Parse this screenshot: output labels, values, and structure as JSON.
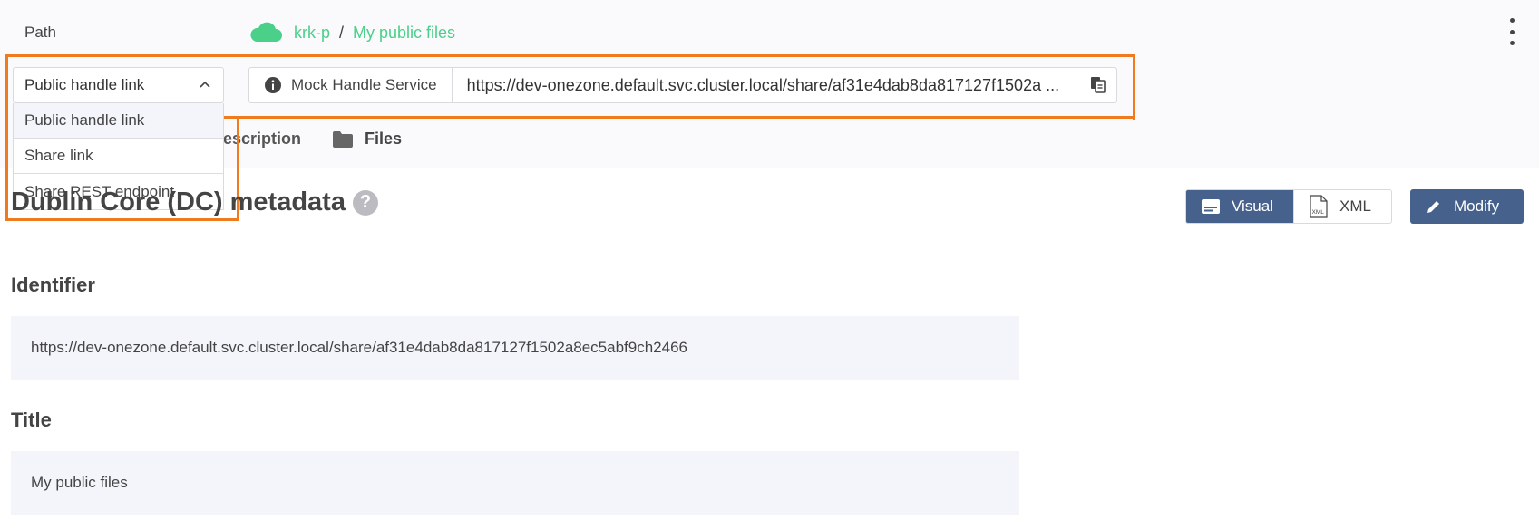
{
  "path": {
    "label": "Path",
    "crumbs": [
      "krk-p",
      "My public files"
    ],
    "separator": "/"
  },
  "link_selector": {
    "selected": "Public handle link",
    "options": [
      "Public handle link",
      "Share link",
      "Share REST endpoint"
    ]
  },
  "handle": {
    "service_name": "Mock Handle Service",
    "url": "https://dev-onezone.default.svc.cluster.local/share/af31e4dab8da817127f1502a ..."
  },
  "tabs": {
    "description": "Description",
    "files": "Files"
  },
  "metadata": {
    "title": "Dublin Core (DC) metadata",
    "help": "?",
    "visual_label": "Visual",
    "xml_label": "XML",
    "modify_label": "Modify",
    "fields": [
      {
        "label": "Identifier",
        "value": "https://dev-onezone.default.svc.cluster.local/share/af31e4dab8da817127f1502a8ec5abf9ch2466"
      },
      {
        "label": "Title",
        "value": "My public files"
      }
    ]
  },
  "colors": {
    "accent_green": "#4bd08a",
    "highlight_orange": "#f07a1e",
    "primary_button": "#46618c"
  },
  "icons": [
    "cloud-icon",
    "kebab-menu-icon",
    "chevron-up-icon",
    "info-icon",
    "copy-icon",
    "folder-icon",
    "help-icon",
    "visual-icon",
    "xml-file-icon",
    "pencil-icon"
  ]
}
